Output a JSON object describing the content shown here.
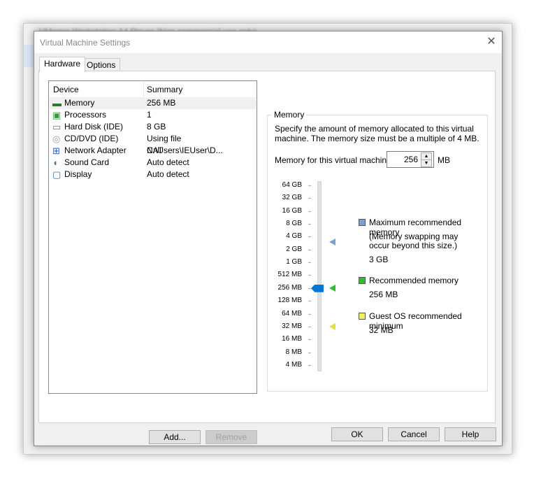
{
  "background_window": {
    "title": "VMware Workstation 14 Player (Non-commercial use only)"
  },
  "dialog": {
    "title": "Virtual Machine Settings",
    "close_icon": "close-icon"
  },
  "tabs": [
    {
      "label": "Hardware",
      "active": true
    },
    {
      "label": "Options",
      "active": false
    }
  ],
  "device_list": {
    "headers": {
      "device": "Device",
      "summary": "Summary"
    },
    "rows": [
      {
        "device": "Memory",
        "summary": "256 MB",
        "icon": "memory-icon",
        "selected": true
      },
      {
        "device": "Processors",
        "summary": "1",
        "icon": "processor-icon"
      },
      {
        "device": "Hard Disk (IDE)",
        "summary": "8 GB",
        "icon": "hard-disk-icon"
      },
      {
        "device": "CD/DVD (IDE)",
        "summary": "Using file C:\\Users\\IEUser\\D...",
        "icon": "cd-dvd-icon"
      },
      {
        "device": "Network Adapter",
        "summary": "NAT",
        "icon": "network-adapter-icon"
      },
      {
        "device": "Sound Card",
        "summary": "Auto detect",
        "icon": "sound-card-icon"
      },
      {
        "device": "Display",
        "summary": "Auto detect",
        "icon": "display-icon"
      }
    ],
    "add_label": "Add...",
    "remove_label": "Remove"
  },
  "memory": {
    "group_label": "Memory",
    "description_line1": "Specify the amount of memory allocated to this virtual",
    "description_line2": "machine. The memory size must be a multiple of 4 MB.",
    "field_label": "Memory for this virtual machine:",
    "value": "256",
    "unit": "MB",
    "slider_ticks": [
      "64 GB",
      "32 GB",
      "16 GB",
      "8 GB",
      "4 GB",
      "2 GB",
      "1 GB",
      "512 MB",
      "256 MB",
      "128 MB",
      "64 MB",
      "32 MB",
      "16 MB",
      "8 MB",
      "4 MB"
    ],
    "slider_value": "256 MB",
    "max_recommended": {
      "label": "Maximum recommended memory",
      "note_line1": "(Memory swapping may",
      "note_line2": "occur beyond this size.)",
      "value": "3 GB",
      "color": "#7f9fd0"
    },
    "recommended": {
      "label": "Recommended memory",
      "value": "256 MB",
      "color": "#33bb33"
    },
    "guest_min": {
      "label": "Guest OS recommended minimum",
      "value": "32 MB",
      "color": "#f0f060"
    }
  },
  "footer": {
    "ok_label": "OK",
    "cancel_label": "Cancel",
    "help_label": "Help"
  }
}
